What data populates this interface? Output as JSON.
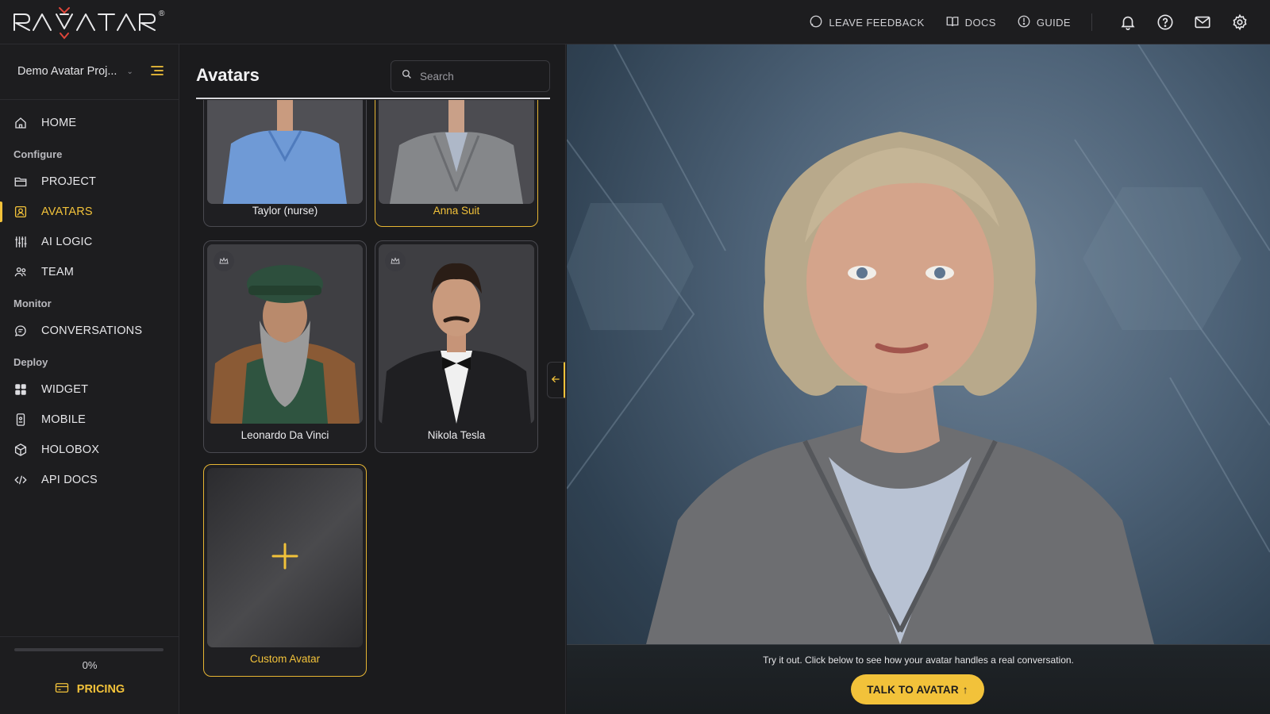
{
  "brand": {
    "logo_text": "RAVATAR",
    "registered_mark": "®",
    "accent_color": "#f2c23a",
    "logo_accent_color": "#e0463a"
  },
  "topbar": {
    "feedback_label": "LEAVE FEEDBACK",
    "docs_label": "DOCS",
    "guide_label": "GUIDE",
    "icons": [
      "bell-icon",
      "help-icon",
      "mail-icon",
      "gear-icon"
    ]
  },
  "sidebar": {
    "project_name": "Demo Avatar Proj...",
    "items": [
      {
        "label": "HOME",
        "icon": "home-icon"
      },
      {
        "label": "PROJECT",
        "icon": "folder-icon"
      },
      {
        "label": "AVATARS",
        "icon": "avatar-icon",
        "active": true
      },
      {
        "label": "AI LOGIC",
        "icon": "sliders-icon"
      },
      {
        "label": "TEAM",
        "icon": "team-icon"
      },
      {
        "label": "CONVERSATIONS",
        "icon": "chat-icon"
      },
      {
        "label": "WIDGET",
        "icon": "grid-icon"
      },
      {
        "label": "MOBILE",
        "icon": "mobile-icon"
      },
      {
        "label": "HOLOBOX",
        "icon": "cube-icon"
      },
      {
        "label": "API DOCS",
        "icon": "code-icon"
      }
    ],
    "sections": {
      "configure": "Configure",
      "monitor": "Monitor",
      "deploy": "Deploy"
    },
    "progress_percent": 0,
    "progress_label": "0%",
    "pricing_label": "PRICING"
  },
  "avatars_panel": {
    "title": "Avatars",
    "search_placeholder": "Search",
    "cards": [
      {
        "name": "Taylor (nurse)",
        "selected": false
      },
      {
        "name": "Anna Suit",
        "selected": true
      },
      {
        "name": "Leonardo Da Vinci",
        "selected": false,
        "badge": "crown-icon"
      },
      {
        "name": "Nikola Tesla",
        "selected": false,
        "badge": "crown-icon"
      },
      {
        "name": "Custom Avatar",
        "selected": false,
        "add": true
      }
    ],
    "add_icon": "+"
  },
  "preview": {
    "hint": "Try it out. Click below to see how your avatar handles a real conversation.",
    "talk_button": "TALK TO AVATAR",
    "talk_button_icon": "↑"
  }
}
